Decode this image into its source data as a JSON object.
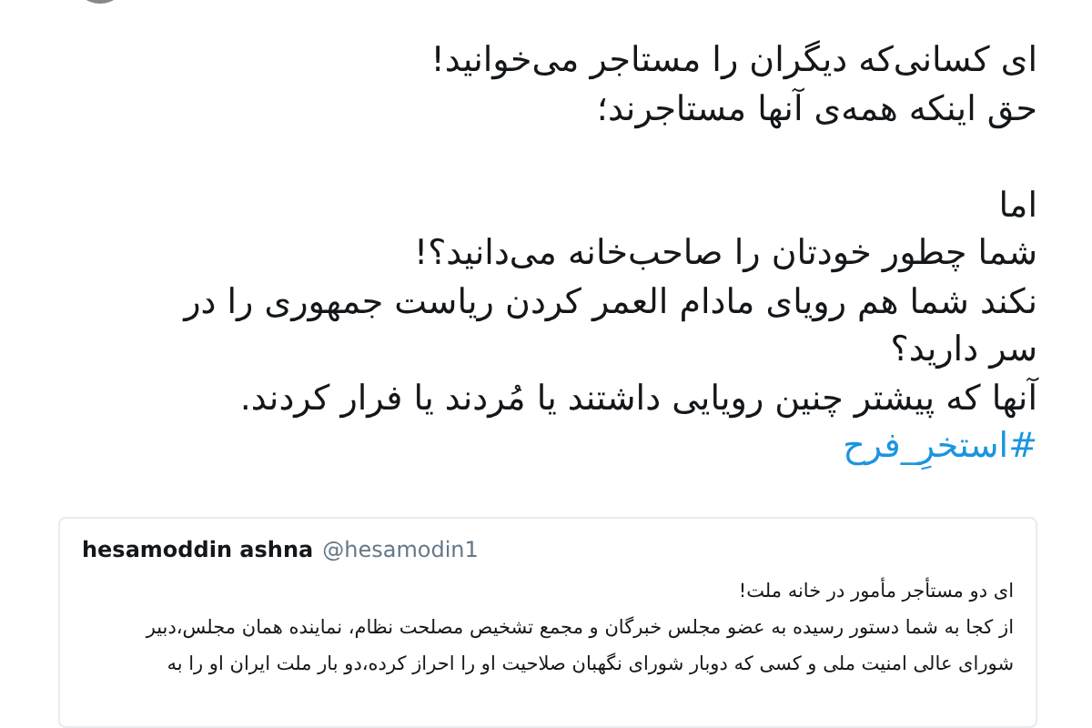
{
  "tweet": {
    "paragraphs": [
      [
        "ای کسانی‌که دیگران را مستاجر می‌خوانید!",
        "حق اینکه همه‌ی آنها مستاجرند؛"
      ],
      [
        "اما",
        "شما چطور خودتان را صاحب‌خانه می‌دانید؟!",
        "نکند شما هم رویای مادام العمر کردن ریاست جمهوری را در",
        "سر دارید؟",
        "آنها که پیشتر چنین رویایی داشتند یا مُردند یا فرار کردند."
      ]
    ],
    "hashtag": "#استخرِ_فرح"
  },
  "quoted": {
    "name": "hesamoddin ashna",
    "handle": "@hesamodin1",
    "lines": [
      "ای دو مستأجر مأمور در خانه ملت!",
      "از کجا به شما دستور رسیده به عضو مجلس خبرگان و مجمع تشخیص مصلحت نظام، نماینده همان مجلس،دبیر",
      "شورای عالی امنیت ملی و کسی که دوبار شورای نگهبان صلاحیت او را احراز کرده،دو بار ملت ایران او را به"
    ]
  }
}
